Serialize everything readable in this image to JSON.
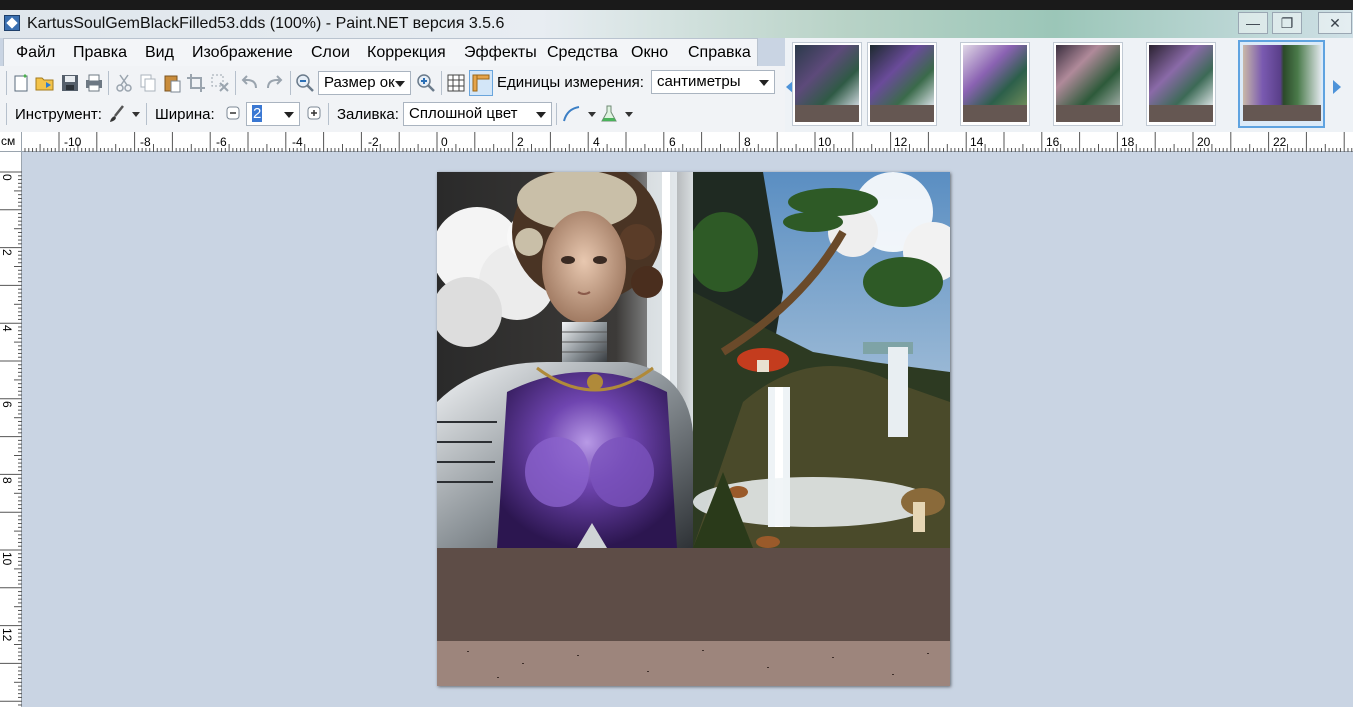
{
  "window": {
    "title": "KartusSoulGemBlackFilled53.dds (100%) - Paint.NET версия 3.5.6",
    "minimize_icon": "minimize-icon",
    "restore_icon": "restore-icon",
    "close_icon": "close-icon"
  },
  "menu": {
    "items": [
      "Файл",
      "Правка",
      "Вид",
      "Изображение",
      "Слои",
      "Коррекция",
      "Эффекты",
      "Средства",
      "Окно",
      "Справка"
    ]
  },
  "toolbar": {
    "zoom_value": "Размер ок",
    "units_label": "Единицы измерения:",
    "units_value": "сантиметры"
  },
  "tool_options": {
    "tool_label": "Инструмент:",
    "width_label": "Ширина:",
    "width_value": "2",
    "fill_label": "Заливка:",
    "fill_value": "Сплошной цвет"
  },
  "ruler": {
    "unit": "см",
    "top_labels": [
      "-10",
      "-8",
      "-6",
      "-4",
      "-2",
      "0",
      "2",
      "4",
      "6",
      "8",
      "10",
      "12",
      "14",
      "16",
      "18",
      "20",
      "22"
    ],
    "left_labels": [
      "0",
      "2",
      "4",
      "6",
      "8",
      "10",
      "12"
    ]
  },
  "colors": {
    "workspace": "#c9d4e3",
    "band_dark": "#5e4d47",
    "band_light": "#9d857c",
    "thumb_active_border": "#5fa3e0"
  }
}
